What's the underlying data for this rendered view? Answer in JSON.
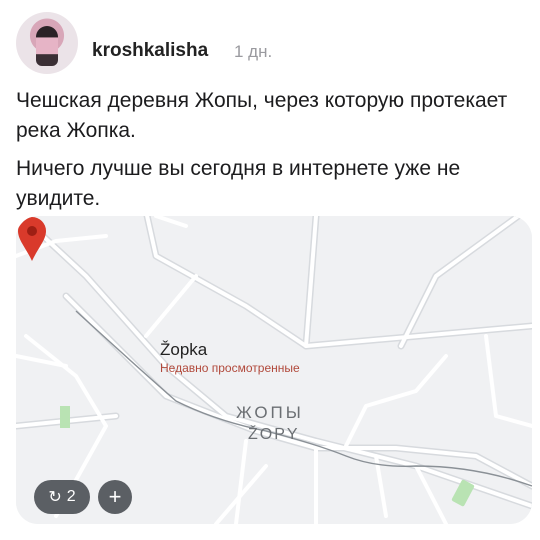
{
  "post": {
    "username": "kroshkalisha",
    "time": "1 дн.",
    "paragraphs": [
      "Чешская деревня Жопы, через которую протекает река Жопка.",
      "Ничего лучше вы сегодня в интернете уже не увидите."
    ]
  },
  "map": {
    "pin_label": "Žopka",
    "pin_sublabel": "Недавно просмотренные",
    "village_label_cyrillic": "ЖОПЫ",
    "village_label_latin": "ŽOPY"
  },
  "actions": {
    "repost_count": "2",
    "add_label": "+"
  },
  "colors": {
    "pin": "#d93a2b",
    "map_bg": "#f0f1f3",
    "road": "#ffffff",
    "green": "#b9e3b3",
    "button_bg": "#5b5f64"
  },
  "icons": {
    "pin": "map-pin-icon",
    "repost": "repost-icon",
    "add": "plus-icon"
  }
}
